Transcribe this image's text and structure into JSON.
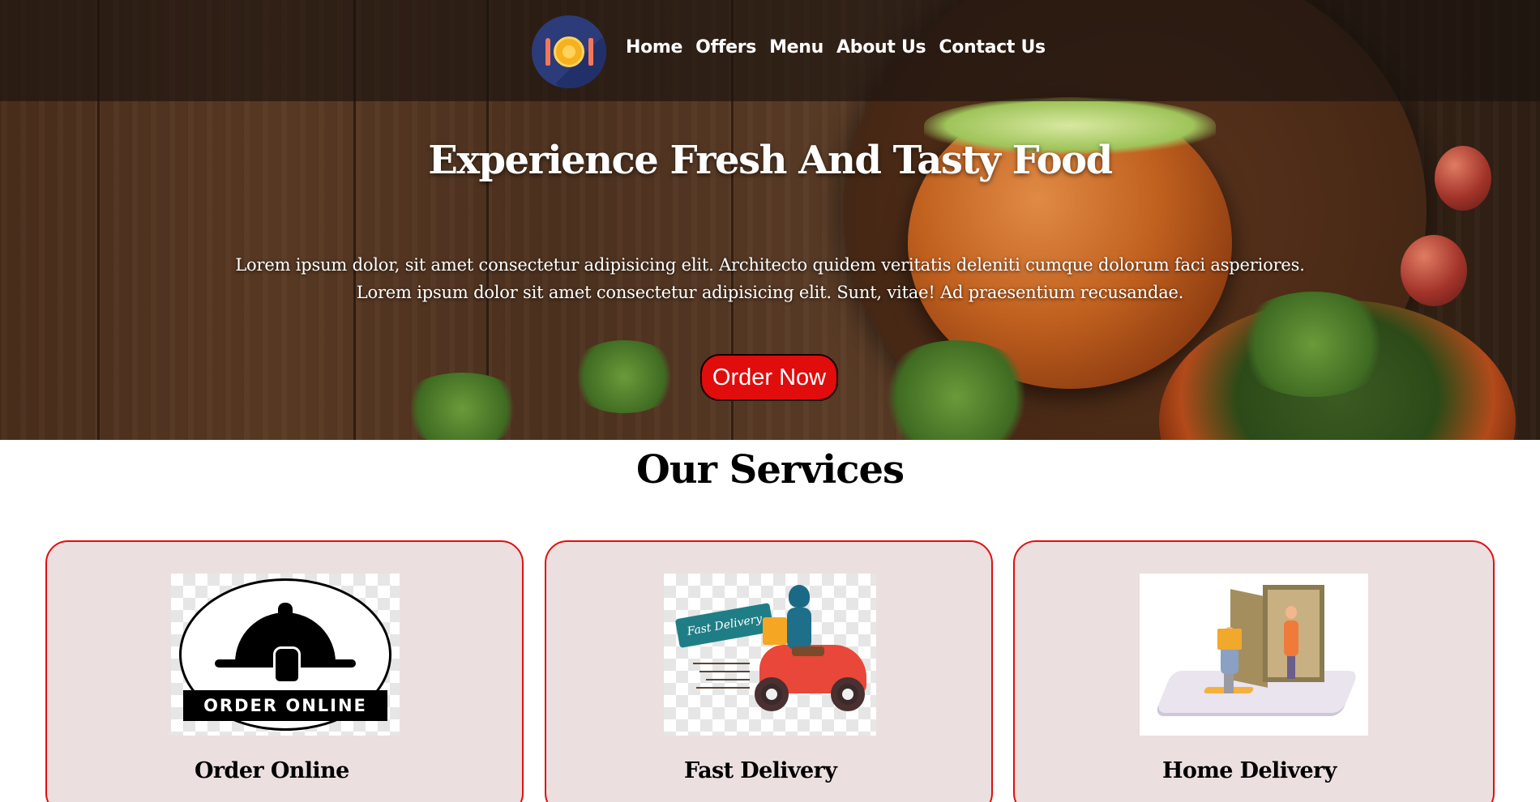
{
  "header": {
    "logo_icon": "plate-fork-spoon-logo",
    "nav": [
      {
        "label": "Home"
      },
      {
        "label": "Offers"
      },
      {
        "label": "Menu"
      },
      {
        "label": "About Us"
      },
      {
        "label": "Contact Us"
      }
    ]
  },
  "hero": {
    "title": "Experience Fresh And Tasty Food",
    "text_line1": "Lorem ipsum dolor, sit amet consectetur adipisicing elit. Architecto quidem veritatis deleniti cumque dolorum faci asperiores.",
    "text_line2": "Lorem ipsum dolor sit amet consectetur adipisicing elit. Sunt, vitae! Ad praesentium recusandae.",
    "cta_label": "Order Now"
  },
  "services": {
    "title": "Our Services",
    "cards": [
      {
        "title": "Order Online",
        "image_icon": "order-online-cloche-icon",
        "image_banner": "ORDER ONLINE"
      },
      {
        "title": "Fast Delivery",
        "image_icon": "delivery-scooter-icon",
        "image_ribbon": "Fast Delivery"
      },
      {
        "title": "Home Delivery",
        "image_icon": "home-delivery-phone-icon"
      }
    ]
  },
  "colors": {
    "accent_red": "#e10c0c",
    "card_background": "#ebdfe0",
    "card_border": "#e00f0f",
    "logo_navy": "#2c3c7a",
    "logo_gold": "#f5b11f"
  }
}
